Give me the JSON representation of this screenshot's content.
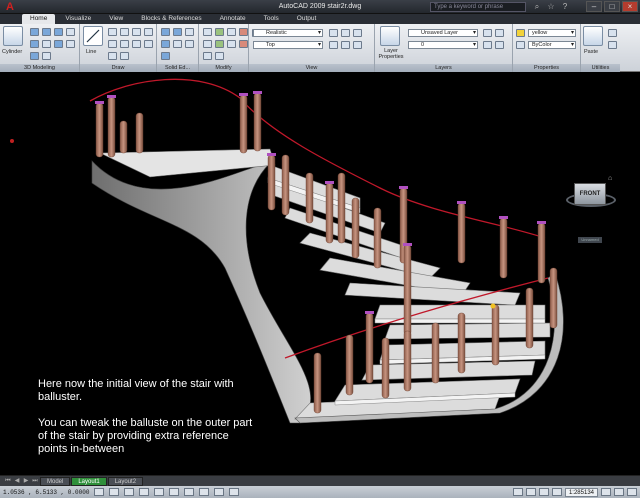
{
  "titlebar": {
    "title": "AutoCAD 2009  stair2r.dwg",
    "search_placeholder": "Type a keyword or phrase"
  },
  "ribbon_tabs": [
    "Home",
    "Visualize",
    "View",
    "Blocks & References",
    "Annotate",
    "Tools",
    "Output"
  ],
  "ribbon": {
    "cylinder_label": "Cylinder",
    "line_label": "Line",
    "visual_style_value": "Realistic",
    "view_value": "Top",
    "layer_properties_label": "Layer Properties",
    "layer_state_value": "Unsaved Layer",
    "layer_value": "0",
    "color_value": "yellow",
    "linetype_value": "ByColor",
    "paste_label": "Paste",
    "panels": [
      "3D Modeling",
      "Draw",
      "Solid Ed...",
      "Modify",
      "View",
      "Layers",
      "Properties",
      "Utilities"
    ]
  },
  "viewcube": {
    "face": "FRONT",
    "ucs_label": "Unnamed"
  },
  "caption": {
    "line1": "Here now the initial view of the stair with balluster.",
    "line2": "You can tweak the balluste on the outer part of the stair by providing extra reference points in-between"
  },
  "layout_tabs": [
    "Model",
    "Layout1",
    "Layout2"
  ],
  "active_layout": "Layout1",
  "status": {
    "coords": "1.0536 , 6.5133 , 0.0000",
    "scale": "1:285134",
    "icons": [
      "snap",
      "grid",
      "ortho",
      "polar",
      "osnap",
      "otrack",
      "ducs",
      "dyn",
      "lwt",
      "qp"
    ]
  },
  "colors": {
    "accent": "#2f8f3a",
    "baluster": "#b9826a",
    "stair": "#d6d6d6",
    "handrail": "#c0182a"
  }
}
